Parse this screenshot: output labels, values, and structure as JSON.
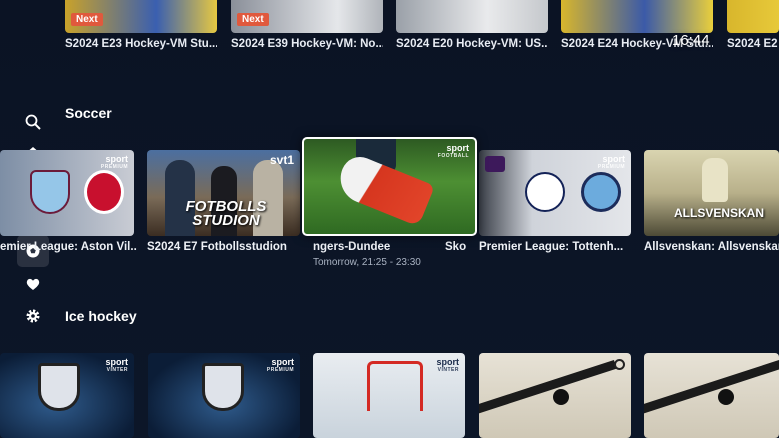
{
  "clock": "16:44",
  "top_row": {
    "next_label": "Next",
    "cards": [
      {
        "title": "S2024 E23  Hockey-VM Stu..."
      },
      {
        "title": "S2024 E39  Hockey-VM: No..."
      },
      {
        "title": "S2024 E20  Hockey-VM: US..."
      },
      {
        "title": "S2024 E24  Hockey-VM Stu..."
      },
      {
        "title": "S2024 E2"
      }
    ]
  },
  "sidebar": [
    {
      "icon": "search-icon"
    },
    {
      "icon": "home-icon"
    },
    {
      "icon": "tv-icon"
    },
    {
      "icon": "movie-icon"
    },
    {
      "icon": "sport-icon"
    },
    {
      "icon": "heart-icon"
    },
    {
      "icon": "gear-icon"
    }
  ],
  "soccer": {
    "title": "Soccer",
    "cards": [
      {
        "title": "emier League: Aston Vil...",
        "badge": "sport",
        "badge_sub": "PREMIUM"
      },
      {
        "title": "S2024 E7  Fotbollsstudion",
        "badge": "svt1",
        "overlay": "FOTBOLLS STUDION"
      },
      {
        "title": "ngers-Dundee",
        "badge": "sport",
        "badge_sub": "FOOTBALL",
        "subtitle": "Tomorrow, 21:25 - 23:30"
      },
      {
        "title": "Sko"
      },
      {
        "title": "Premier League: Tottenh...",
        "badge": "sport",
        "badge_sub": "PREMIUM"
      },
      {
        "title": "Allsvenskan: Allsvenskan",
        "overlay": "ALLSVENSKAN"
      }
    ]
  },
  "icehockey": {
    "title": "Ice hockey",
    "cards": [
      {
        "badge": "sport",
        "badge_sub": "VINTER"
      },
      {
        "badge": "sport",
        "badge_sub": "PREMIUM"
      },
      {
        "badge": "sport",
        "badge_sub": "VINTER"
      },
      {},
      {}
    ]
  },
  "colors": {
    "background": "#0c1426",
    "next_badge": "#e0593d",
    "focus_border": "#ffffff"
  }
}
